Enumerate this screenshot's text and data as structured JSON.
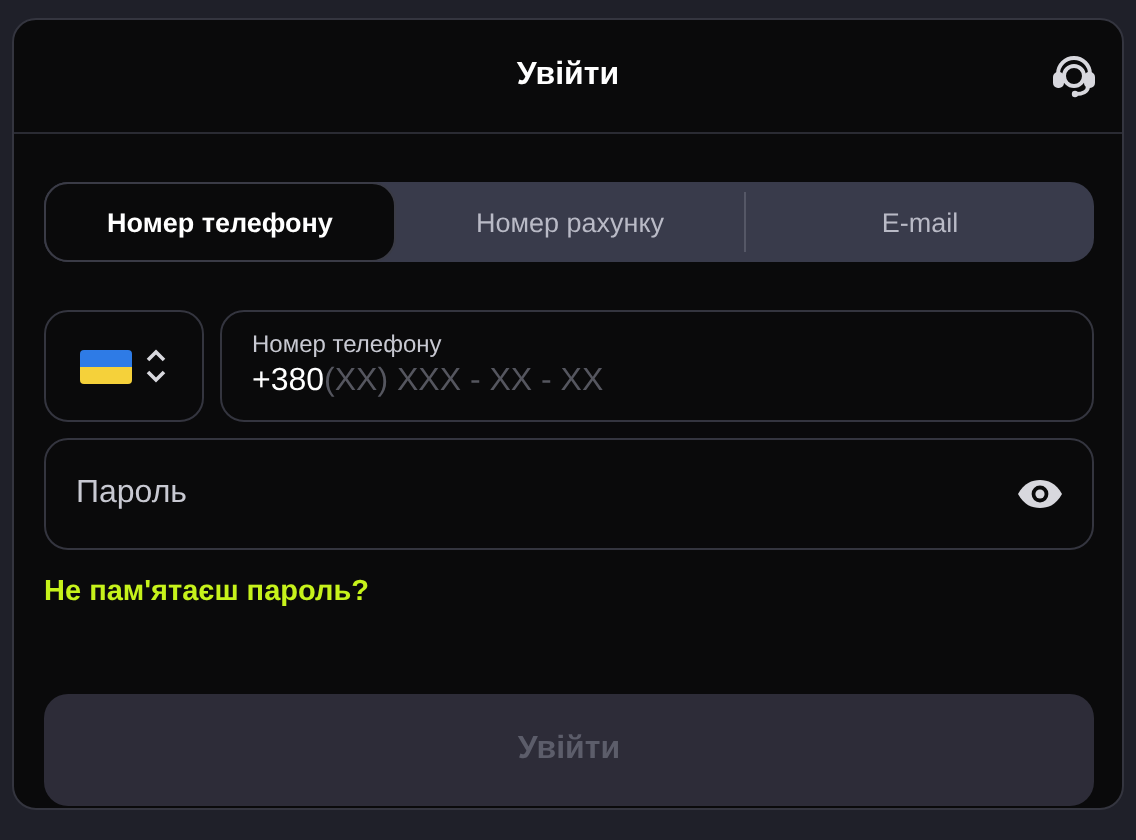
{
  "dialog": {
    "title": "Увійти"
  },
  "tabs": [
    {
      "label": "Номер телефону",
      "selected": true
    },
    {
      "label": "Номер рахунку",
      "selected": false
    },
    {
      "label": "E-mail",
      "selected": false
    }
  ],
  "phone": {
    "label": "Номер телефону",
    "value": "+380",
    "mask": "(XX) XXX - XX - XX"
  },
  "password": {
    "placeholder": "Пароль"
  },
  "forgot_link": "Не пам'ятаєш пароль?",
  "submit": {
    "label": "Увійти",
    "disabled": true
  }
}
